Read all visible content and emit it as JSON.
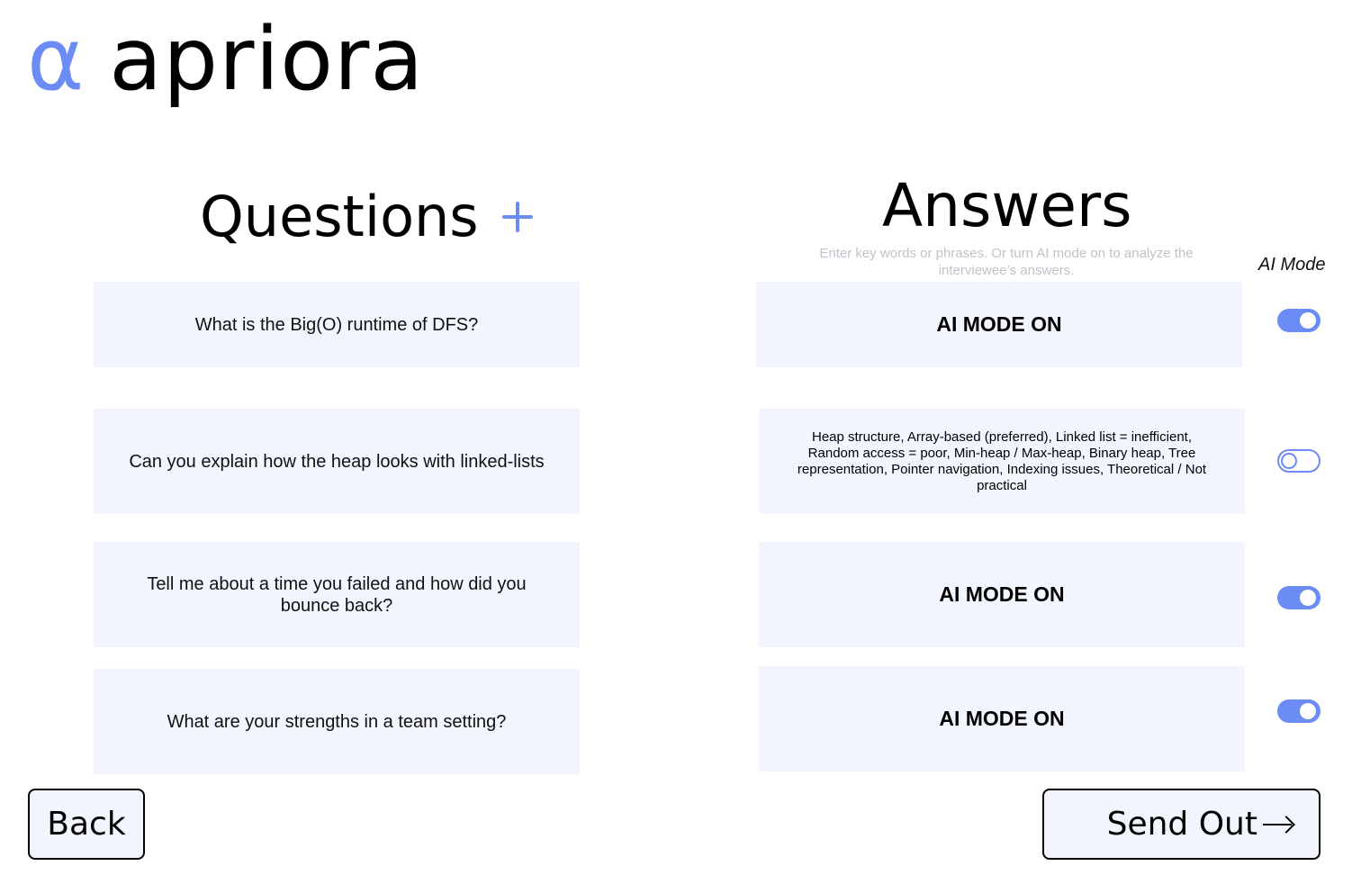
{
  "brand": {
    "mark": "α",
    "name": "apriora",
    "accent_color": "#6b8bf5"
  },
  "questions": {
    "title": "Questions",
    "add_icon": "plus-icon",
    "items": [
      {
        "text": "What is the Big(O) runtime of DFS?"
      },
      {
        "text": "Can you explain how the heap looks with linked-lists"
      },
      {
        "text": "Tell me about a time you failed and how did you bounce back?"
      },
      {
        "text": "What are your strengths in a team setting?"
      }
    ]
  },
  "answers": {
    "title": "Answers",
    "hint": "Enter key words or phrases. Or turn AI mode on to analyze the interviewee’s answers.",
    "ai_mode_label": "AI Mode",
    "items": [
      {
        "text": "AI MODE ON",
        "ai_mode": true
      },
      {
        "text": "Heap structure, Array-based (preferred), Linked list = inefficient, Random access = poor, Min-heap / Max-heap, Binary heap, Tree representation, Pointer navigation, Indexing issues, Theoretical / Not practical",
        "ai_mode": false
      },
      {
        "text": "AI MODE ON",
        "ai_mode": true
      },
      {
        "text": "AI MODE ON",
        "ai_mode": true
      }
    ]
  },
  "footer": {
    "back_label": "Back",
    "send_label": "Send Out",
    "send_icon": "arrow-right-icon"
  },
  "colors": {
    "card_bg": "#f2f5fe",
    "accent": "#6b8bf5",
    "hint_text": "#bfc2c8"
  }
}
